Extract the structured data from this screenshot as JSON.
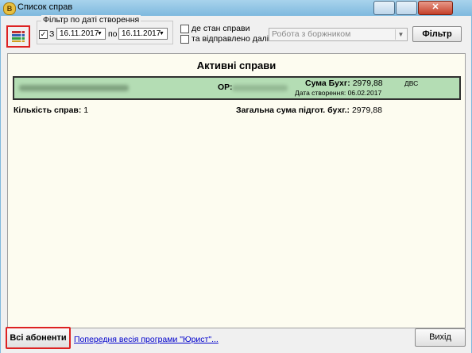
{
  "window": {
    "title": "Список справ",
    "app_icon_letter": "B"
  },
  "filter": {
    "group_label": "Фільтр по даті створення",
    "enabled_checked": true,
    "from_label": "З",
    "date_from": "16.11.2017",
    "to_label": "по",
    "date_to": "16.11.2017",
    "where_state_label": "де стан справи",
    "sent_label": "та відправлено далі",
    "state_combo_value": "Робота з боржником",
    "filter_button": "Фільтр"
  },
  "panel": {
    "title": "Активні справи",
    "case": {
      "op_label": "ОР:",
      "sum_label": "Сума Бухг:",
      "sum_value": "2979,88",
      "dvs": "ДВС",
      "created_label": "Дата створення:",
      "created_date": "06.02.2017"
    },
    "count_label": "Кількість справ:",
    "count_value": "1",
    "total_label": "Загальна сума підгот. бухг.:",
    "total_value": "2979,88"
  },
  "footer": {
    "all_subscribers": "Всі абоненти",
    "prev_version_link": "Попередня весія програми \"Юрист\"...",
    "exit": "Вихід"
  },
  "colors": {
    "titlebar": "#7fb9de",
    "panel_bg": "#fdfcf0",
    "case_row": "#b4ddb4",
    "highlight_border": "#dd2222",
    "link": "#0000cc"
  }
}
